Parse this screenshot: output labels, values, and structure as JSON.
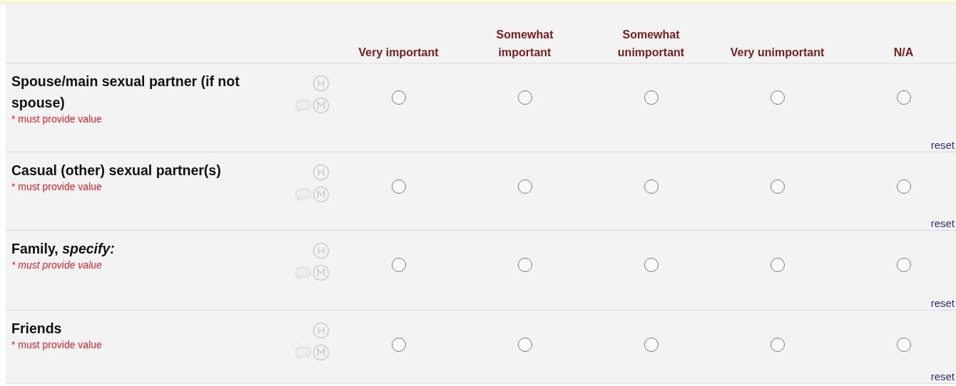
{
  "columns": [
    "Very important",
    "Somewhat important",
    "Somewhat unimportant",
    "Very unimportant",
    "N/A"
  ],
  "rows": [
    {
      "label": "Spouse/main sexual partner (if not spouse)",
      "note": "* must provide value",
      "note_italic": false,
      "choices": [
        {
          "selected": false
        },
        {
          "selected": false
        },
        {
          "selected": false
        },
        {
          "selected": false
        },
        {
          "selected": false
        }
      ],
      "reset": "reset"
    },
    {
      "label": "Casual (other) sexual partner(s)",
      "note": "* must provide value",
      "note_italic": false,
      "choices": [
        {
          "selected": false
        },
        {
          "selected": false
        },
        {
          "selected": false
        },
        {
          "selected": false
        },
        {
          "selected": false
        }
      ],
      "reset": "reset"
    },
    {
      "label": "Family, *specify:*",
      "note": "* must provide value",
      "note_italic": true,
      "choices": [
        {
          "selected": false
        },
        {
          "selected": false
        },
        {
          "selected": false
        },
        {
          "selected": false
        },
        {
          "selected": false
        }
      ],
      "reset": "reset"
    },
    {
      "label": "Friends",
      "note": "* must provide value",
      "note_italic": false,
      "choices": [
        {
          "selected": false
        },
        {
          "selected": false
        },
        {
          "selected": false
        },
        {
          "selected": false
        },
        {
          "selected": false
        }
      ],
      "reset": "reset"
    }
  ]
}
